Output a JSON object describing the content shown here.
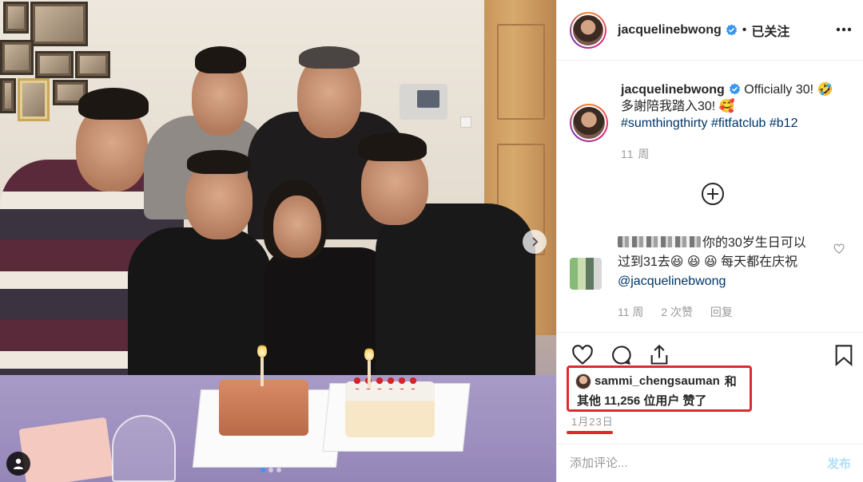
{
  "post": {
    "author": "jacquelinebwong",
    "follow_separator": "•",
    "follow_state": "已关注",
    "caption_line1": "Officially 30! 🤣",
    "caption_line2": "多謝陪我踏入30! 🥰",
    "hashtags": "#sumthingthirty #fitfatclub #b12",
    "caption_time": "11 周",
    "likes_first": "sammi_chengsauman",
    "likes_first_suffix": "和",
    "likes_rest": "其他 11,256 位用户 赞了",
    "date": "1月23日"
  },
  "comment": {
    "text": "你的30岁生日可以过到31去😆 😆 😆  每天都在庆祝",
    "mention": "@jacquelinebwong",
    "time": "11 周",
    "likes": "2 次赞",
    "reply": "回复"
  },
  "composer": {
    "placeholder": "添加评论...",
    "post_label": "发布"
  },
  "carousel": {
    "slides": 3,
    "active_index": 0
  },
  "colors": {
    "accent": "#3897f0",
    "highlight": "#e0292f",
    "hashtag": "#003569",
    "muted": "#999999"
  }
}
